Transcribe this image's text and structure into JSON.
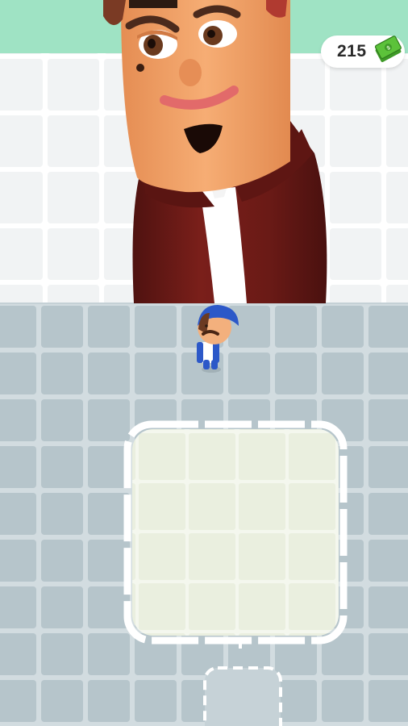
{
  "hud": {
    "settings_icon": "gear-icon",
    "currency_amount": "215",
    "currency_icon": "cash-stack-icon"
  },
  "colors": {
    "backdrop_grass": "#9fe3c4",
    "back_floor": "#eef1f3",
    "front_floor": "#b9c7cd",
    "drop_zone": "#eef2e4",
    "suit": "#6d1a17",
    "skin": "#f3a468",
    "cap": "#2c58c8",
    "cash": "#5cc23a"
  }
}
